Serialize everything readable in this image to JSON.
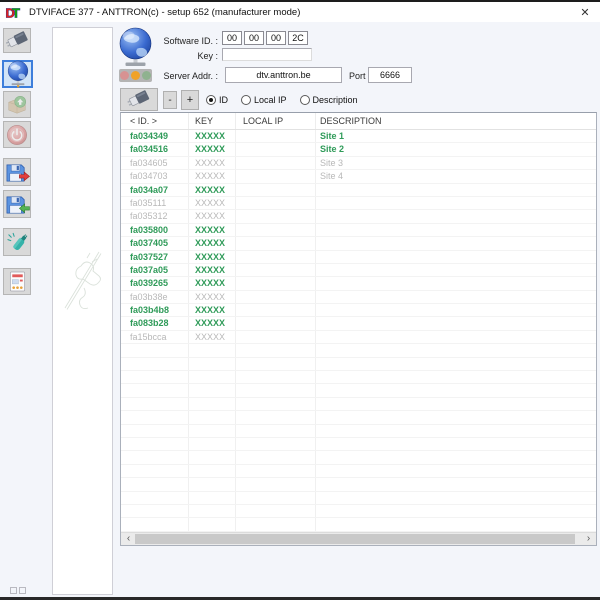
{
  "window": {
    "title": "DTVIFACE 377 - ANTTRON(c) - setup 652 (manufacturer mode)",
    "app_logo": "DT",
    "close_icon": "✕"
  },
  "sidebar": {
    "icons": [
      {
        "name": "usb-plug-icon",
        "state": "enabled"
      },
      {
        "name": "network-globe-icon",
        "state": "selected"
      },
      {
        "name": "upload-box-icon",
        "state": "disabled"
      },
      {
        "name": "power-icon",
        "state": "disabled"
      },
      {
        "name": "floppy-export-icon",
        "state": "enabled"
      },
      {
        "name": "floppy-import-icon",
        "state": "enabled"
      },
      {
        "name": "program-plug-icon",
        "state": "enabled"
      },
      {
        "name": "device-card-icon",
        "state": "enabled"
      }
    ]
  },
  "connection": {
    "software_id_label": "Software ID. :",
    "software_id": [
      "00",
      "00",
      "00",
      "2C"
    ],
    "key_label": "Key :",
    "key_value": "",
    "server_label": "Server Addr. :",
    "server_value": "dtv.anttron.be",
    "port_label": "Port :",
    "port_value": "6666",
    "status_lights": [
      "red",
      "amber",
      "green"
    ],
    "status_active_light": "amber"
  },
  "toolbar": {
    "minus_label": "-",
    "plus_label": "+",
    "radios": [
      {
        "label": "ID",
        "selected": true
      },
      {
        "label": "Local IP",
        "selected": false
      },
      {
        "label": "Description",
        "selected": false
      }
    ]
  },
  "table": {
    "columns": [
      "< ID. >",
      "KEY",
      "LOCAL IP",
      "DESCRIPTION"
    ],
    "rows": [
      {
        "id": "fa034349",
        "key": "XXXXX",
        "local_ip": "",
        "description": "Site 1",
        "state": "active"
      },
      {
        "id": "fa034516",
        "key": "XXXXX",
        "local_ip": "",
        "description": "Site 2",
        "state": "active"
      },
      {
        "id": "fa034605",
        "key": "XXXXX",
        "local_ip": "",
        "description": "Site 3",
        "state": "inactive"
      },
      {
        "id": "fa034703",
        "key": "XXXXX",
        "local_ip": "",
        "description": "Site 4",
        "state": "inactive"
      },
      {
        "id": "fa034a07",
        "key": "XXXXX",
        "local_ip": "",
        "description": "",
        "state": "active"
      },
      {
        "id": "fa035111",
        "key": "XXXXX",
        "local_ip": "",
        "description": "",
        "state": "inactive"
      },
      {
        "id": "fa035312",
        "key": "XXXXX",
        "local_ip": "",
        "description": "",
        "state": "inactive"
      },
      {
        "id": "fa035800",
        "key": "XXXXX",
        "local_ip": "",
        "description": "",
        "state": "active"
      },
      {
        "id": "fa037405",
        "key": "XXXXX",
        "local_ip": "",
        "description": "",
        "state": "active"
      },
      {
        "id": "fa037527",
        "key": "XXXXX",
        "local_ip": "",
        "description": "",
        "state": "active"
      },
      {
        "id": "fa037a05",
        "key": "XXXXX",
        "local_ip": "",
        "description": "",
        "state": "active"
      },
      {
        "id": "fa039265",
        "key": "XXXXX",
        "local_ip": "",
        "description": "",
        "state": "active"
      },
      {
        "id": "fa03b38e",
        "key": "XXXXX",
        "local_ip": "",
        "description": "",
        "state": "inactive"
      },
      {
        "id": "fa03b4b8",
        "key": "XXXXX",
        "local_ip": "",
        "description": "",
        "state": "active"
      },
      {
        "id": "fa083b28",
        "key": "XXXXX",
        "local_ip": "",
        "description": "",
        "state": "active"
      },
      {
        "id": "fa15bcca",
        "key": "XXXXX",
        "local_ip": "",
        "description": "",
        "state": "inactive"
      }
    ]
  },
  "scrollbar": {
    "left_arrow": "‹",
    "right_arrow": "›"
  },
  "colors": {
    "active_row_green": "#2f9b59",
    "inactive_row_gray": "#b8b8b8",
    "selected_button_blue": "#3d7edb",
    "amber_light": "#f0a228",
    "titlebar_bg": "#ffffff",
    "app_bg": "#f3f5fa"
  }
}
